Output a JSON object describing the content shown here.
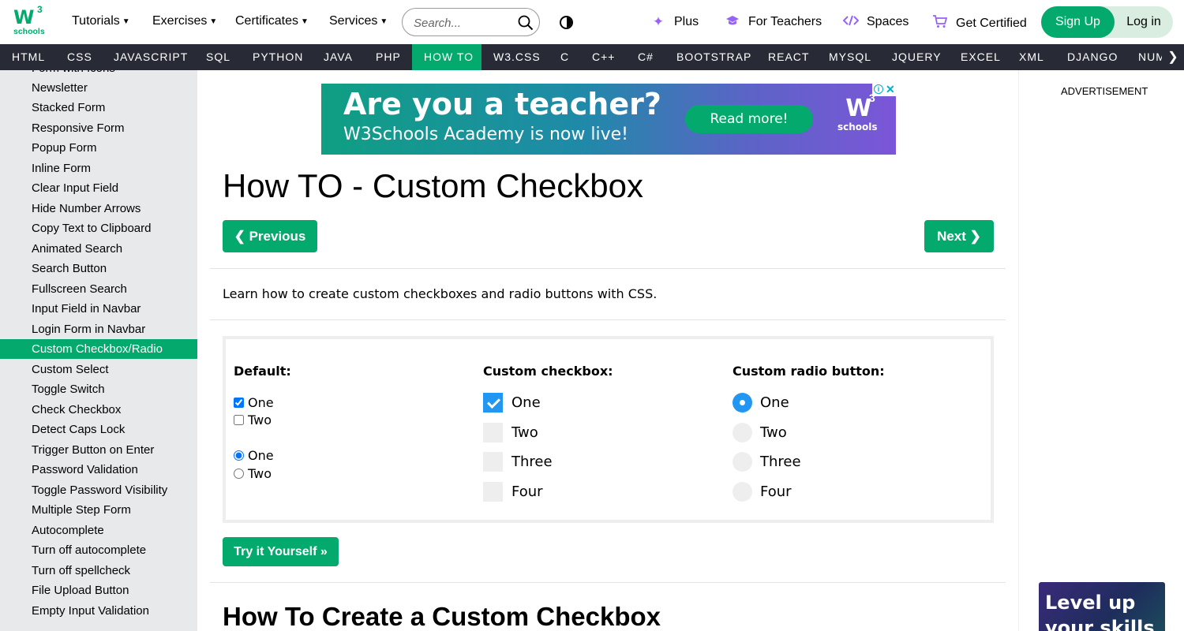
{
  "header": {
    "logo": {
      "letter": "W",
      "superscript": "3",
      "subtitle": "schools"
    },
    "menus": [
      "Tutorials",
      "Exercises",
      "Certificates",
      "Services"
    ],
    "search": {
      "placeholder": "Search..."
    },
    "links": {
      "plus": "Plus",
      "teachers": "For Teachers",
      "spaces": "Spaces",
      "certified": "Get Certified"
    },
    "signup": "Sign Up",
    "login": "Log in"
  },
  "nav": {
    "items": [
      "HTML",
      "CSS",
      "JAVASCRIPT",
      "SQL",
      "PYTHON",
      "JAVA",
      "PHP",
      "HOW TO",
      "W3.CSS",
      "C",
      "C++",
      "C#",
      "BOOTSTRAP",
      "REACT",
      "MYSQL",
      "JQUERY",
      "EXCEL",
      "XML",
      "DJANGO",
      "NUMPY"
    ],
    "active": "HOW TO"
  },
  "sidebar": {
    "items": [
      "Form with Icons",
      "Newsletter",
      "Stacked Form",
      "Responsive Form",
      "Popup Form",
      "Inline Form",
      "Clear Input Field",
      "Hide Number Arrows",
      "Copy Text to Clipboard",
      "Animated Search",
      "Search Button",
      "Fullscreen Search",
      "Input Field in Navbar",
      "Login Form in Navbar",
      "Custom Checkbox/Radio",
      "Custom Select",
      "Toggle Switch",
      "Check Checkbox",
      "Detect Caps Lock",
      "Trigger Button on Enter",
      "Password Validation",
      "Toggle Password Visibility",
      "Multiple Step Form",
      "Autocomplete",
      "Turn off autocomplete",
      "Turn off spellcheck",
      "File Upload Button",
      "Empty Input Validation"
    ],
    "active": "Custom Checkbox/Radio"
  },
  "ad": {
    "headline": "Are you a teacher?",
    "subline": "W3Schools Academy is now live!",
    "button": "Read more!",
    "logo_letter": "W",
    "logo_superscript": "3",
    "logo_text": "schools"
  },
  "main": {
    "title": "How TO - Custom Checkbox",
    "prev": "❮ Previous",
    "next": "Next ❯",
    "intro": "Learn how to create custom checkboxes and radio buttons with CSS.",
    "try_button": "Try it Yourself »",
    "section_title": "How To Create a Custom Checkbox"
  },
  "demo": {
    "default_heading": "Default:",
    "default_checkboxes": [
      {
        "label": "One",
        "checked": true
      },
      {
        "label": "Two",
        "checked": false
      }
    ],
    "default_radios": [
      {
        "label": "One",
        "checked": true
      },
      {
        "label": "Two",
        "checked": false
      }
    ],
    "custom_checkbox_heading": "Custom checkbox:",
    "custom_checkboxes": [
      {
        "label": "One",
        "checked": true
      },
      {
        "label": "Two",
        "checked": false
      },
      {
        "label": "Three",
        "checked": false
      },
      {
        "label": "Four",
        "checked": false
      }
    ],
    "custom_radio_heading": "Custom radio button:",
    "custom_radios": [
      {
        "label": "One",
        "checked": true
      },
      {
        "label": "Two",
        "checked": false
      },
      {
        "label": "Three",
        "checked": false
      },
      {
        "label": "Four",
        "checked": false
      }
    ]
  },
  "right": {
    "advertisement_label": "ADVERTISEMENT",
    "promo_line1": "Level up",
    "promo_line2": "your skills"
  },
  "colors": {
    "brand_green": "#04AA6D",
    "nav_bg": "#282A35",
    "sidebar_bg": "#E7E9EB",
    "custom_control_blue": "#2196F3"
  }
}
